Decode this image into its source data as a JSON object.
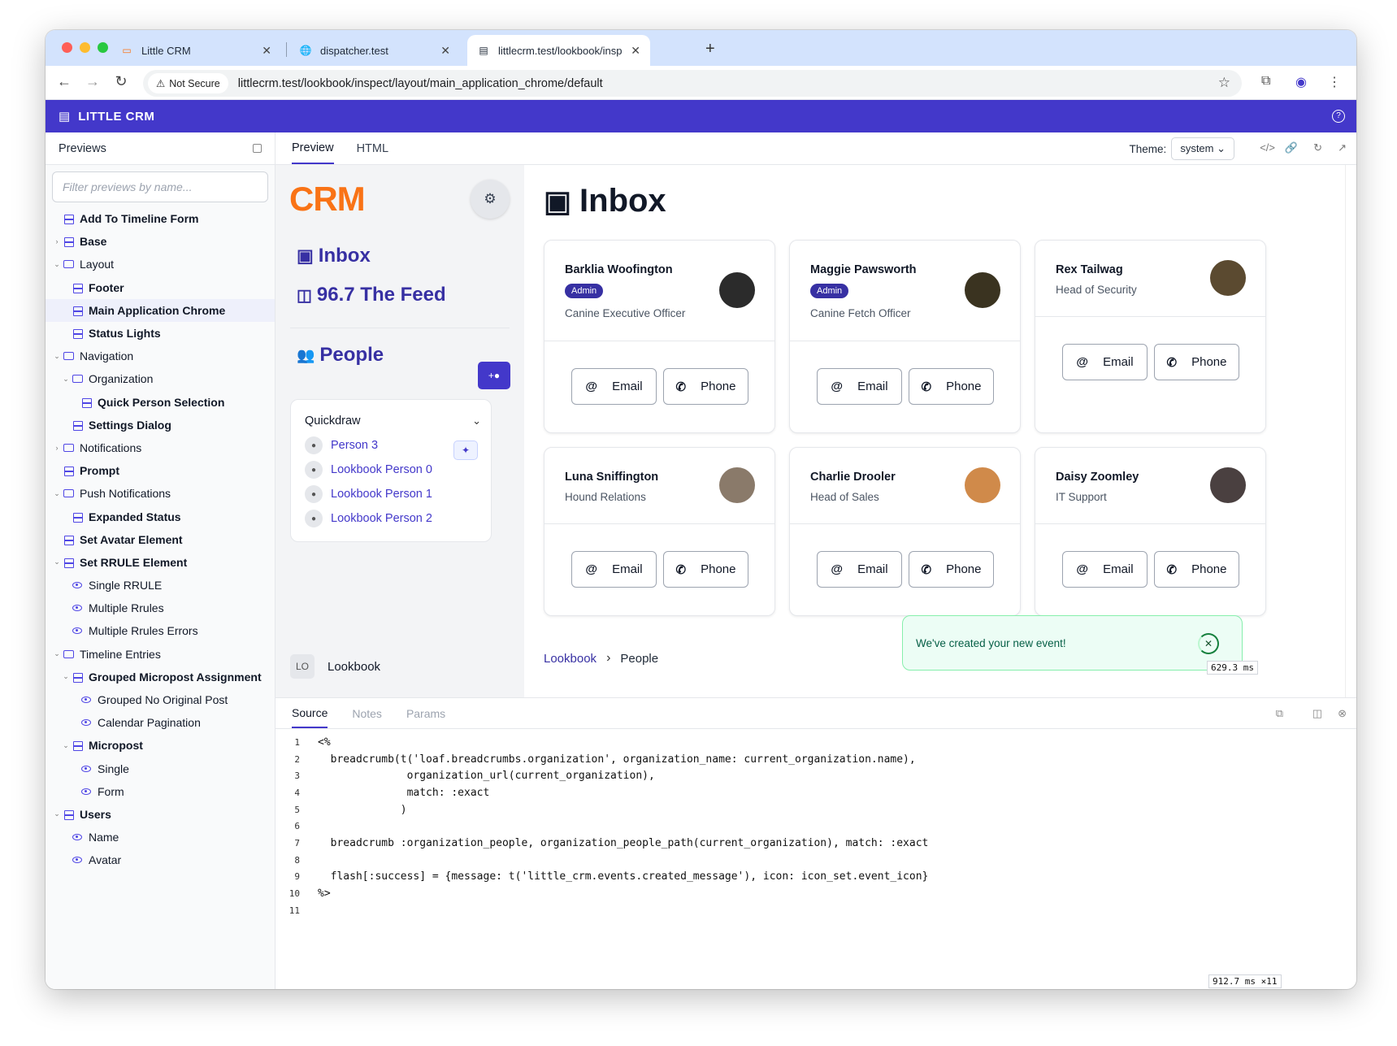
{
  "browser": {
    "tabs": [
      {
        "title": "Little CRM",
        "icon": "crm-favicon-icon"
      },
      {
        "title": "dispatcher.test",
        "icon": "globe-icon"
      },
      {
        "title": "littlecrm.test/lookbook/inspec",
        "icon": "page-icon"
      }
    ],
    "security_label": "Not Secure",
    "url": "littlecrm.test/lookbook/inspect/layout/main_application_chrome/default"
  },
  "app": {
    "name": "LITTLE CRM",
    "accent": "#4338ca"
  },
  "sidebar": {
    "title": "Previews",
    "filter_placeholder": "Filter previews by name...",
    "items": [
      {
        "label": "Add To Timeline Form",
        "indent": 0,
        "chevron": "",
        "icon": "stack",
        "bold": true
      },
      {
        "label": "Base",
        "indent": 0,
        "chevron": "right",
        "icon": "stack",
        "bold": true
      },
      {
        "label": "Layout",
        "indent": 0,
        "chevron": "down",
        "icon": "folder",
        "bold": false
      },
      {
        "label": "Footer",
        "indent": 1,
        "chevron": "",
        "icon": "stack",
        "bold": true
      },
      {
        "label": "Main Application Chrome",
        "indent": 1,
        "chevron": "",
        "icon": "stack",
        "bold": true,
        "selected": true
      },
      {
        "label": "Status Lights",
        "indent": 1,
        "chevron": "",
        "icon": "stack",
        "bold": true
      },
      {
        "label": "Navigation",
        "indent": 0,
        "chevron": "down",
        "icon": "folder",
        "bold": false
      },
      {
        "label": "Organization",
        "indent": 1,
        "chevron": "down",
        "icon": "folder",
        "bold": false
      },
      {
        "label": "Quick Person Selection",
        "indent": 2,
        "chevron": "",
        "icon": "stack",
        "bold": true
      },
      {
        "label": "Settings Dialog",
        "indent": 1,
        "chevron": "",
        "icon": "stack",
        "bold": true
      },
      {
        "label": "Notifications",
        "indent": 0,
        "chevron": "right",
        "icon": "folder",
        "bold": false
      },
      {
        "label": "Prompt",
        "indent": 0,
        "chevron": "",
        "icon": "stack",
        "bold": true
      },
      {
        "label": "Push Notifications",
        "indent": 0,
        "chevron": "down",
        "icon": "folder",
        "bold": false
      },
      {
        "label": "Expanded Status",
        "indent": 1,
        "chevron": "",
        "icon": "stack",
        "bold": true
      },
      {
        "label": "Set Avatar Element",
        "indent": 0,
        "chevron": "",
        "icon": "stack",
        "bold": true
      },
      {
        "label": "Set RRULE Element",
        "indent": 0,
        "chevron": "down",
        "icon": "stack",
        "bold": true
      },
      {
        "label": "Single RRULE",
        "indent": 1,
        "chevron": "",
        "icon": "eye",
        "bold": false
      },
      {
        "label": "Multiple Rrules",
        "indent": 1,
        "chevron": "",
        "icon": "eye",
        "bold": false
      },
      {
        "label": "Multiple Rrules Errors",
        "indent": 1,
        "chevron": "",
        "icon": "eye",
        "bold": false
      },
      {
        "label": "Timeline Entries",
        "indent": 0,
        "chevron": "down",
        "icon": "folder",
        "bold": false
      },
      {
        "label": "Grouped Micropost Assignment",
        "indent": 1,
        "chevron": "down",
        "icon": "stack",
        "bold": true
      },
      {
        "label": "Grouped No Original Post",
        "indent": 2,
        "chevron": "",
        "icon": "eye",
        "bold": false
      },
      {
        "label": "Calendar Pagination",
        "indent": 2,
        "chevron": "",
        "icon": "eye",
        "bold": false
      },
      {
        "label": "Micropost",
        "indent": 1,
        "chevron": "down",
        "icon": "stack",
        "bold": true
      },
      {
        "label": "Single",
        "indent": 2,
        "chevron": "",
        "icon": "eye",
        "bold": false
      },
      {
        "label": "Form",
        "indent": 2,
        "chevron": "",
        "icon": "eye",
        "bold": false
      },
      {
        "label": "Users",
        "indent": 0,
        "chevron": "down",
        "icon": "stack",
        "bold": true
      },
      {
        "label": "Name",
        "indent": 1,
        "chevron": "",
        "icon": "eye",
        "bold": false
      },
      {
        "label": "Avatar",
        "indent": 1,
        "chevron": "",
        "icon": "eye",
        "bold": false
      }
    ]
  },
  "preview_tabs": {
    "preview": "Preview",
    "html": "HTML",
    "theme_label": "Theme:",
    "theme_value": "system"
  },
  "inner_nav": {
    "logo": "CRM",
    "inbox": "Inbox",
    "feed": "96.7 The Feed",
    "people": "People",
    "quickdraw": {
      "title": "Quickdraw",
      "people": [
        "Person 3",
        "Lookbook Person 0",
        "Lookbook Person 1",
        "Lookbook Person 2"
      ]
    },
    "footer_initials": "LO",
    "footer_name": "Lookbook"
  },
  "inbox": {
    "title": "Inbox",
    "cards": [
      {
        "name": "Barklia Woofington",
        "badge": "Admin",
        "role": "Canine Executive Officer",
        "avatar_color": "#2b2b2b"
      },
      {
        "name": "Maggie Pawsworth",
        "badge": "Admin",
        "role": "Canine Fetch Officer",
        "avatar_color": "#3a3320"
      },
      {
        "name": "Rex Tailwag",
        "badge": "",
        "role": "Head of Security",
        "avatar_color": "#5b4a30"
      },
      {
        "name": "Luna Sniffington",
        "badge": "",
        "role": "Hound Relations",
        "avatar_color": "#8a7a6a"
      },
      {
        "name": "Charlie Drooler",
        "badge": "",
        "role": "Head of Sales",
        "avatar_color": "#d08a4a"
      },
      {
        "name": "Daisy Zoomley",
        "badge": "",
        "role": "IT Support",
        "avatar_color": "#4a4040"
      }
    ],
    "email_label": "Email",
    "phone_label": "Phone"
  },
  "breadcrumb": {
    "root": "Lookbook",
    "current": "People"
  },
  "toast": {
    "message": "We've created your new event!"
  },
  "timers": {
    "preview": "629.3",
    "preview_unit": "ms",
    "source": "912.7",
    "source_unit": "ms ×11"
  },
  "source_tabs": {
    "source": "Source",
    "notes": "Notes",
    "params": "Params"
  },
  "code_lines": [
    "<%",
    "  breadcrumb(t('loaf.breadcrumbs.organization', organization_name: current_organization.name),",
    "              organization_url(current_organization),",
    "              match: :exact",
    "             )",
    "",
    "  breadcrumb :organization_people, organization_people_path(current_organization), match: :exact",
    "",
    "  flash[:success] = {message: t('little_crm.events.created_message'), icon: icon_set.event_icon}",
    "%>",
    ""
  ]
}
